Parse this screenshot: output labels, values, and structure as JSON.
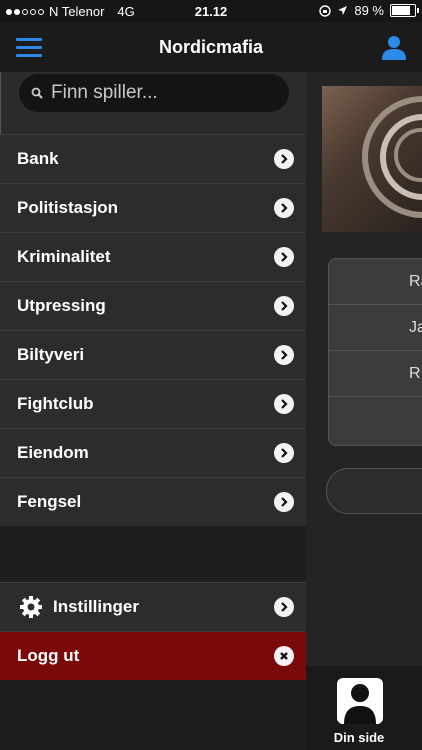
{
  "status": {
    "carrier": "N Telenor",
    "network": "4G",
    "time": "21.12",
    "battery": "89 %",
    "battery_level": 0.89
  },
  "header": {
    "title": "Nordicmafia"
  },
  "search": {
    "placeholder": "Finn spiller..."
  },
  "menu": {
    "items": [
      {
        "label": "Bank"
      },
      {
        "label": "Politistasjon"
      },
      {
        "label": "Kriminalitet"
      },
      {
        "label": "Utpressing"
      },
      {
        "label": "Biltyveri"
      },
      {
        "label": "Fightclub"
      },
      {
        "label": "Eiendom"
      },
      {
        "label": "Fengsel"
      }
    ],
    "settings": "Instillinger",
    "logout": "Logg ut"
  },
  "content": {
    "rows": [
      {
        "text": "Ra"
      },
      {
        "text": "Ja"
      },
      {
        "text": "R"
      },
      {
        "text": ""
      }
    ]
  },
  "tabbar": {
    "label": "Din side"
  },
  "colors": {
    "accent": "#2c8ae8",
    "logout_bg": "#7a0a0a"
  }
}
